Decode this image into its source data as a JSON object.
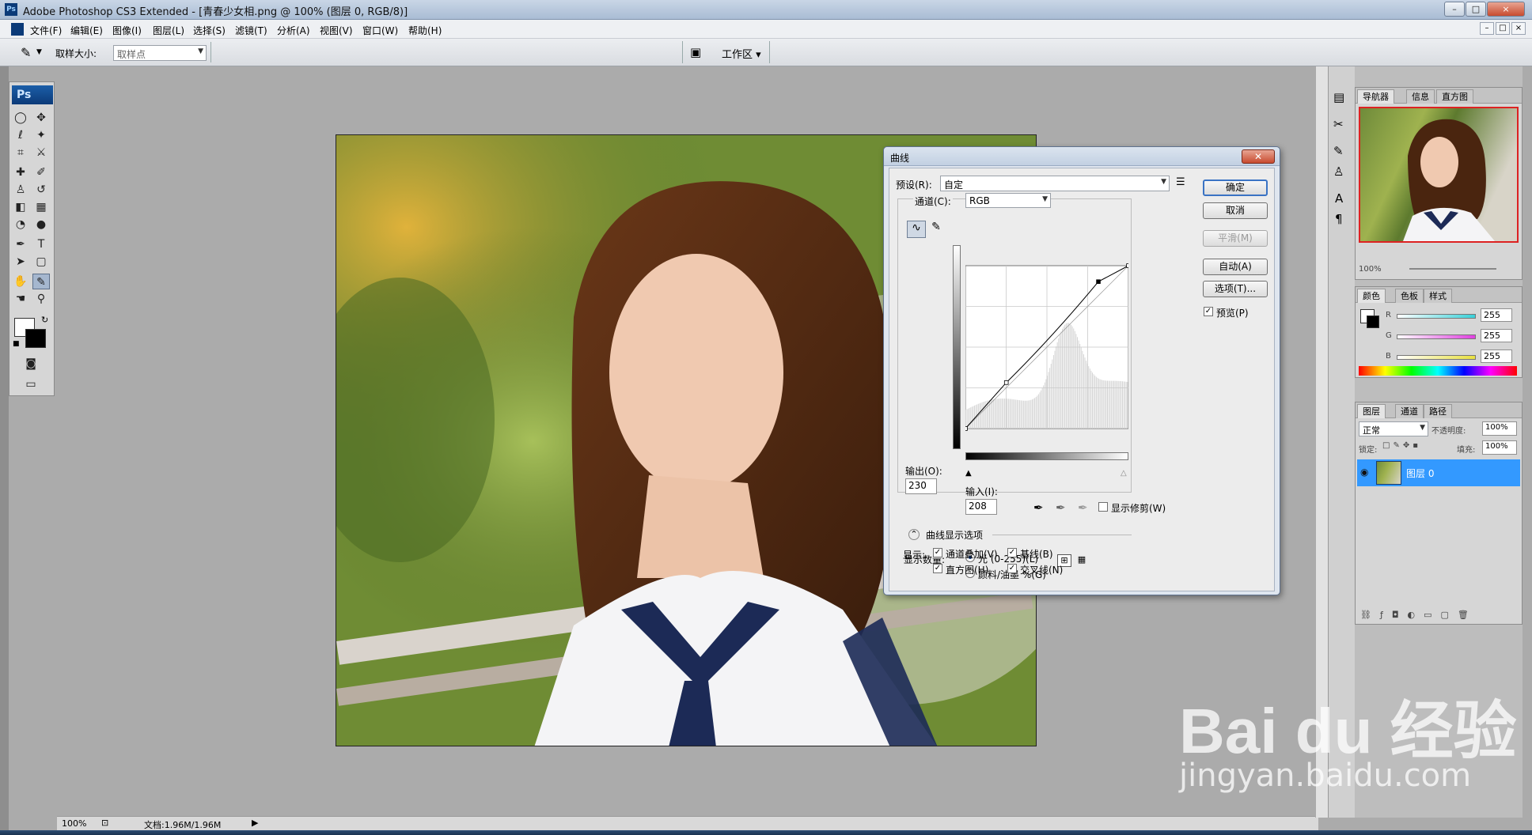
{
  "app": {
    "title": "Adobe Photoshop CS3 Extended - [青春少女相.png @ 100% (图层 0, RGB/8)]",
    "logo": "Ps",
    "window_controls": [
      "–",
      "□",
      "×"
    ],
    "doc_controls": [
      "–",
      "□",
      "×"
    ]
  },
  "menu": {
    "items": [
      "文件(F)",
      "编辑(E)",
      "图像(I)",
      "图层(L)",
      "选择(S)",
      "滤镜(T)",
      "分析(A)",
      "视图(V)",
      "窗口(W)",
      "帮助(H)"
    ]
  },
  "options": {
    "sample_size_label": "取样大小:",
    "sample_size_value": "取样点",
    "workspace_label": "工作区 ▾"
  },
  "toolbox": {
    "title": "Ps"
  },
  "status": {
    "zoom": "100%",
    "doc": "文档:1.96M/1.96M"
  },
  "navigator": {
    "tabs": [
      "导航器",
      "信息",
      "直方图"
    ],
    "zoom": "100%"
  },
  "color_panel": {
    "tabs": [
      "颜色",
      "色板",
      "样式"
    ],
    "r_label": "R",
    "g_label": "G",
    "b_label": "B",
    "r": "255",
    "g": "255",
    "b": "255",
    "accent_r": "#39d0d8",
    "accent_g": "#e040e0",
    "accent_b": "#e8e040"
  },
  "layers_panel": {
    "tabs": [
      "图层",
      "通道",
      "路径"
    ],
    "blend_mode": "正常",
    "opacity_label": "不透明度:",
    "opacity": "100%",
    "lock_label": "锁定:",
    "fill_label": "填充:",
    "fill": "100%",
    "layer_name": "图层 0"
  },
  "curves_dialog": {
    "title": "曲线",
    "preset_label": "预设(R):",
    "preset_value": "自定",
    "channel_label": "通道(C):",
    "channel_value": "RGB",
    "output_label": "输出(O):",
    "output_value": "230",
    "input_label": "输入(I):",
    "input_value": "208",
    "show_clipping": "显示修剪(W)",
    "curve_options_label": "曲线显示选项",
    "show_amount_label": "显示数量:",
    "light_option": "光 (0-255)(L)",
    "pigment_option": "颜料/油墨 %(G)",
    "show_label": "显示:",
    "channel_overlays": "通道叠加(V)",
    "baseline": "基线(B)",
    "histogram": "直方图(H)",
    "intersection": "交叉线(N)",
    "buttons": {
      "ok": "确定",
      "cancel": "取消",
      "smooth": "平滑(M)",
      "auto": "自动(A)",
      "options": "选项(T)..."
    },
    "preview_label": "预览(P)",
    "curve_points": [
      [
        0,
        0
      ],
      [
        64,
        72
      ],
      [
        208,
        230
      ],
      [
        255,
        255
      ]
    ]
  },
  "watermark": {
    "brand": "Bai du 经验",
    "url": "jingyan.baidu.com"
  }
}
